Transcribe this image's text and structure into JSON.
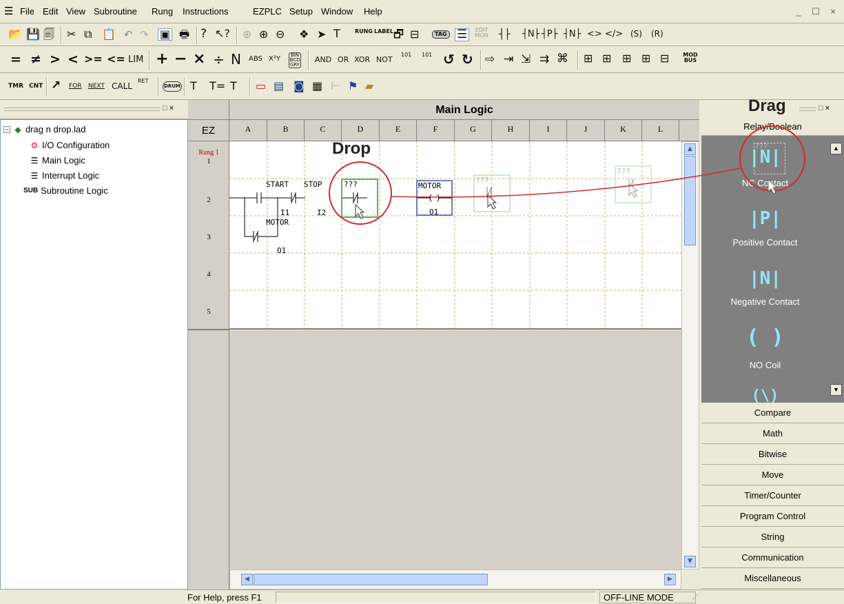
{
  "menu": {
    "items": [
      "File",
      "Edit",
      "View",
      "Subroutine",
      "Rung",
      "Instructions",
      "EZPLC",
      "Setup",
      "Window",
      "Help"
    ],
    "window_controls": "_ ☐ ×"
  },
  "toolbar": {
    "row2_text": [
      "=",
      "≠",
      ">",
      "<",
      ">=",
      "<=",
      "LIM",
      "+",
      "−",
      "×",
      "÷",
      "N",
      "ABS",
      "X²Y",
      "BIN BCD GRY",
      "AND",
      "OR",
      "XOR",
      "NOT",
      "101",
      "101"
    ],
    "row3_text": [
      "TMR",
      "CNT",
      "FOR",
      "NEXT",
      "CALL",
      "RET",
      "DRUM",
      "T",
      "T=",
      "T"
    ],
    "row1_labels": [
      "RUNG",
      "LABEL",
      "TAG",
      "EDIT MON",
      "(S)",
      "(R)"
    ],
    "modbus_label": "MOD BUS"
  },
  "tree": {
    "project": "drag n drop.lad",
    "items": [
      {
        "label": "I/O Configuration",
        "icon": "io-config-icon"
      },
      {
        "label": "Main Logic",
        "icon": "ladder-icon"
      },
      {
        "label": "Interrupt Logic",
        "icon": "ladder-icon"
      },
      {
        "label": "Subroutine Logic",
        "icon": "sub-icon",
        "prefix": "SUB"
      }
    ]
  },
  "editor": {
    "title": "Main Logic",
    "corner": "EZ",
    "columns": [
      "A",
      "B",
      "C",
      "D",
      "E",
      "F",
      "G",
      "H",
      "I",
      "J",
      "K",
      "L"
    ],
    "rung_label": "Rung 1",
    "rows": [
      "1",
      "2",
      "3",
      "4",
      "5"
    ],
    "elements": {
      "start_tag": "START",
      "start_addr": "I1",
      "stop_tag": "STOP",
      "stop_addr": "I2",
      "new_tag": "???",
      "motor_tag": "MOTOR",
      "motor_addr": "O1",
      "latch_tag": "MOTOR",
      "latch_addr": "O1",
      "ghost1_tag": "???",
      "ghost2_tag": "???"
    }
  },
  "annotations": {
    "drag": "Drag",
    "drop": "Drop"
  },
  "palette": {
    "header": "Relay/Boolean",
    "items": [
      {
        "label": "NC Contact",
        "glyph": "|N|"
      },
      {
        "label": "Positive Contact",
        "glyph": "|P|"
      },
      {
        "label": "Negative Contact",
        "glyph": "|N|"
      },
      {
        "label": "NO Coil",
        "glyph": "( )"
      },
      {
        "label": "",
        "glyph": "(\\)"
      }
    ],
    "selected_tag": "???",
    "categories": [
      "Compare",
      "Math",
      "Bitwise",
      "Move",
      "Timer/Counter",
      "Program Control",
      "String",
      "Communication",
      "Miscellaneous"
    ]
  },
  "status": {
    "help": "For Help, press F1",
    "mode": "OFF-LINE MODE"
  },
  "colors": {
    "accent_red": "#d22a2a",
    "palette_bg": "#808080",
    "glyph_cyan": "#8fe7f7",
    "rung_red": "#c00000"
  }
}
